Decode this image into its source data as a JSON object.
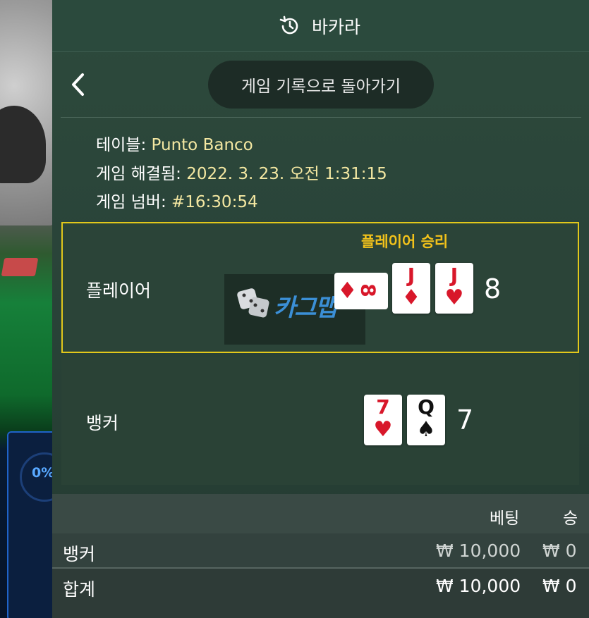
{
  "header": {
    "title": "바카라",
    "history_icon": "history-icon"
  },
  "nav": {
    "back_label": "게임 기록으로 돌아가기",
    "back_icon": "chevron-left-icon"
  },
  "info": {
    "table_label": "테이블:",
    "table_value": "Punto Banco",
    "resolved_label": "게임 해결됨:",
    "resolved_value": "2022. 3. 23. 오전 1:31:15",
    "number_label": "게임 넘버:",
    "number_value": "#16:30:54"
  },
  "player": {
    "label": "플레이어",
    "result": "플레이어 승리",
    "cards": [
      {
        "rank": "8",
        "suit": "♦",
        "color": "red",
        "rotated": true
      },
      {
        "rank": "J",
        "suit": "♦",
        "color": "red"
      },
      {
        "rank": "J",
        "suit": "♥",
        "color": "red"
      }
    ],
    "score": "8"
  },
  "banker": {
    "label": "뱅커",
    "cards": [
      {
        "rank": "7",
        "suit": "♥",
        "color": "red"
      },
      {
        "rank": "Q",
        "suit": "♠",
        "color": "black"
      }
    ],
    "score": "7"
  },
  "watermark": {
    "text": "카그맵"
  },
  "side_panel": {
    "percent": "0%"
  },
  "bets": {
    "col_bet": "베팅",
    "col_win": "승",
    "rows": [
      {
        "label": "뱅커",
        "bet": "₩ 10,000",
        "win": "₩ 0"
      },
      {
        "label": "합계",
        "bet": "₩ 10,000",
        "win": "₩ 0"
      }
    ]
  },
  "colors": {
    "accent_yellow": "#e2c81b",
    "card_red": "#d8172a",
    "panel_green": "#2d4a3c"
  }
}
